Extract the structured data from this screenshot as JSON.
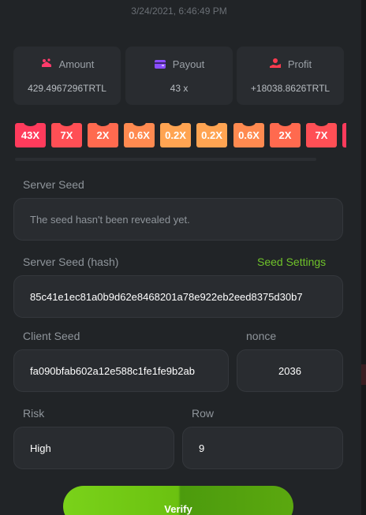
{
  "timestamp": "3/24/2021, 6:46:49 PM",
  "stats": {
    "amount": {
      "label": "Amount",
      "value": "429.4967296TRTL",
      "color": "#ff3b6b"
    },
    "payout": {
      "label": "Payout",
      "value": "43 x",
      "color": "#8a4dff"
    },
    "profit": {
      "label": "Profit",
      "value": "+18038.8626TRTL",
      "color": "#ff3b4f"
    }
  },
  "multipliers": [
    {
      "label": "43X",
      "color": "#ff3b5c"
    },
    {
      "label": "7X",
      "color": "#ff4f55"
    },
    {
      "label": "2X",
      "color": "#ff6a4f"
    },
    {
      "label": "0.6X",
      "color": "#ff8a50"
    },
    {
      "label": "0.2X",
      "color": "#ffa452"
    },
    {
      "label": "0.2X",
      "color": "#ffa452"
    },
    {
      "label": "0.6X",
      "color": "#ff8a50"
    },
    {
      "label": "2X",
      "color": "#ff6a4f"
    },
    {
      "label": "7X",
      "color": "#ff4f55"
    },
    {
      "label": "",
      "color": "#ff3b5c"
    }
  ],
  "server_seed": {
    "label": "Server Seed",
    "value": "The seed hasn't been revealed yet."
  },
  "server_seed_hash": {
    "label": "Server Seed (hash)",
    "link": "Seed Settings",
    "value": "85c41e1ec81a0b9d62e8468201a78e922eb2eed8375d30b7"
  },
  "client_seed": {
    "label": "Client Seed",
    "value": "fa090bfab602a12e588c1fe1fe9b2ab"
  },
  "nonce": {
    "label": "nonce",
    "value": "2036"
  },
  "risk": {
    "label": "Risk",
    "value": "High"
  },
  "row": {
    "label": "Row",
    "value": "9"
  },
  "verify_label": "Verify",
  "accent": "#6fc22a"
}
